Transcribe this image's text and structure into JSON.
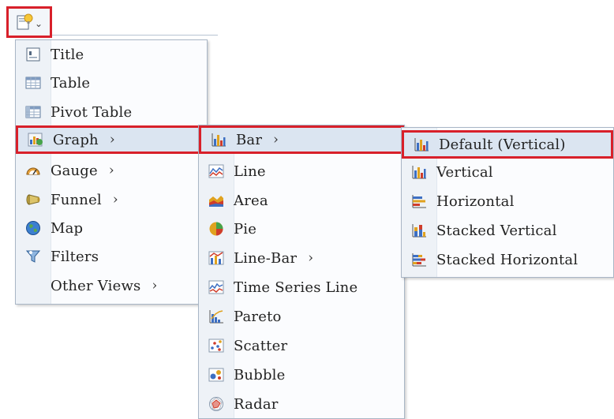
{
  "toolbar": {
    "icon": "new-view-icon",
    "dropdown_icon": "chevron-down-icon"
  },
  "menu_main": {
    "items": [
      {
        "label": "Title",
        "icon": "title-icon"
      },
      {
        "label": "Table",
        "icon": "table-icon"
      },
      {
        "label": "Pivot Table",
        "icon": "pivot-table-icon"
      },
      {
        "label": "Graph",
        "icon": "graph-icon",
        "submenu": true,
        "selected": true
      },
      {
        "label": "Gauge",
        "icon": "gauge-icon",
        "submenu": true
      },
      {
        "label": "Funnel",
        "icon": "funnel-icon",
        "submenu": true
      },
      {
        "label": "Map",
        "icon": "map-icon"
      },
      {
        "label": "Filters",
        "icon": "filters-icon"
      },
      {
        "label": "Other Views",
        "icon": "",
        "submenu": true
      }
    ]
  },
  "menu_graph": {
    "items": [
      {
        "label": "Bar",
        "icon": "bar-chart-icon",
        "submenu": true,
        "selected": true
      },
      {
        "label": "Line",
        "icon": "line-chart-icon"
      },
      {
        "label": "Area",
        "icon": "area-chart-icon"
      },
      {
        "label": "Pie",
        "icon": "pie-chart-icon"
      },
      {
        "label": "Line-Bar",
        "icon": "line-bar-chart-icon",
        "submenu": true
      },
      {
        "label": "Time Series Line",
        "icon": "time-series-icon"
      },
      {
        "label": "Pareto",
        "icon": "pareto-chart-icon"
      },
      {
        "label": "Scatter",
        "icon": "scatter-chart-icon"
      },
      {
        "label": "Bubble",
        "icon": "bubble-chart-icon"
      },
      {
        "label": "Radar",
        "icon": "radar-chart-icon"
      }
    ]
  },
  "menu_bar": {
    "items": [
      {
        "label": "Default (Vertical)",
        "icon": "bar-vertical-icon",
        "selected": true
      },
      {
        "label": "Vertical",
        "icon": "bar-vertical-icon"
      },
      {
        "label": "Horizontal",
        "icon": "bar-horizontal-icon"
      },
      {
        "label": "Stacked Vertical",
        "icon": "stacked-vertical-icon"
      },
      {
        "label": "Stacked Horizontal",
        "icon": "stacked-horizontal-icon"
      }
    ]
  },
  "submenu_arrow": "›"
}
